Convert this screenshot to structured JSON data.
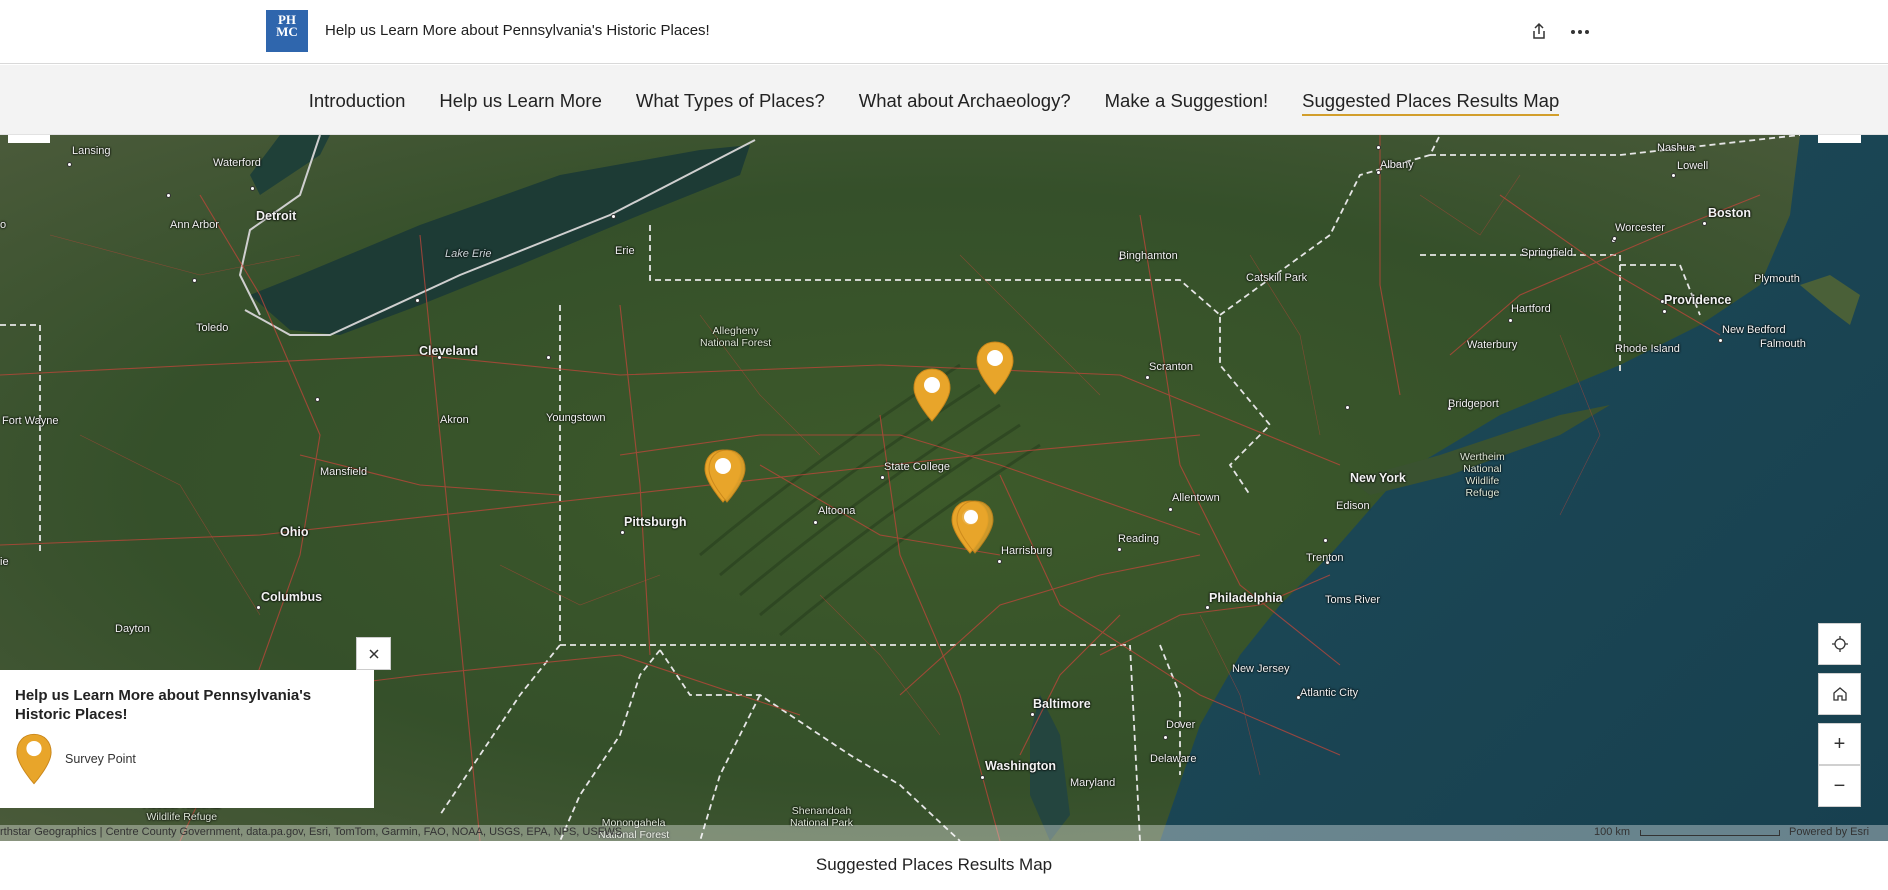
{
  "header": {
    "logo_text": "PHMC",
    "title": "Help us Learn More about Pennsylvania's Historic Places!",
    "share_icon": "share-icon",
    "more_icon": "more-horizontal-icon"
  },
  "nav": {
    "items": [
      {
        "label": "Introduction",
        "active": false
      },
      {
        "label": "Help us Learn More",
        "active": false
      },
      {
        "label": "What Types of Places?",
        "active": false
      },
      {
        "label": "What about Archaeology?",
        "active": false
      },
      {
        "label": "Make a Suggestion!",
        "active": false
      },
      {
        "label": "Suggested Places Results Map",
        "active": true
      }
    ],
    "accent_color": "#d29e2b"
  },
  "map": {
    "labels": {
      "lansing": "Lansing",
      "waterford": "Waterford",
      "detroit": "Detroit",
      "ann_arbor": "Ann Arbor",
      "toledo": "Toledo",
      "lake_erie": "Lake Erie",
      "erie": "Erie",
      "cleveland": "Cleveland",
      "akron": "Akron",
      "fort_wayne": "Fort Wayne",
      "mansfield": "Mansfield",
      "youngstown": "Youngstown",
      "allegheny": "Allegheny\nNational Forest",
      "ohio": "Ohio",
      "columbus": "Columbus",
      "dayton": "Dayton",
      "pittsburgh": "Pittsburgh",
      "state_college": "State College",
      "altoona": "Altoona",
      "harrisburg": "Harrisburg",
      "reading": "Reading",
      "allentown": "Allentown",
      "scranton": "Scranton",
      "binghamton": "Binghamton",
      "catskill": "Catskill Park",
      "albany": "Albany",
      "nashua": "Nashua",
      "lowell": "Lowell",
      "boston": "Boston",
      "worcester": "Worcester",
      "springfield": "Springfield",
      "plymouth": "Plymouth",
      "providence": "Providence",
      "hartford": "Hartford",
      "new_bedford": "New Bedford",
      "falmouth": "Falmouth",
      "waterbury": "Waterbury",
      "rhode_island": "Rhode Island",
      "bridgeport": "Bridgeport",
      "wertheim": "Wertheim\nNational\nWildlife\nRefuge",
      "new_york": "New York",
      "edison": "Edison",
      "trenton": "Trenton",
      "philadelphia": "Philadelphia",
      "toms_river": "Toms River",
      "new_jersey": "New Jersey",
      "atlantic_city": "Atlantic City",
      "baltimore": "Baltimore",
      "dover": "Dover",
      "delaware": "Delaware",
      "washington": "Washington",
      "maryland": "Maryland",
      "shenandoah": "Shenandoah\nNational Park",
      "monongahela": "Monongahela\nNational Forest",
      "hoosier": "Hoosier National\nWildlife Refuge",
      "ohio_edge": "o",
      "ie_edge": "ie"
    },
    "pin_color": "#e8a52a",
    "pin_icon": "map-pin-icon"
  },
  "legend": {
    "title": "Help us Learn More about Pennsylvania's Historic Places!",
    "item_label": "Survey Point",
    "close_icon": "close-icon"
  },
  "controls": {
    "locate_icon": "locate-icon",
    "home_icon": "home-icon",
    "zoom_in": "+",
    "zoom_out": "−"
  },
  "attribution": {
    "text": "rthstar Geographics | Centre County Government, data.pa.gov, Esri, TomTom, Garmin, FAO, NOAA, USGS, EPA, NPS, USFWS",
    "scale": "100 km",
    "powered_by": "Powered by Esri"
  },
  "caption": "Suggested Places Results Map"
}
